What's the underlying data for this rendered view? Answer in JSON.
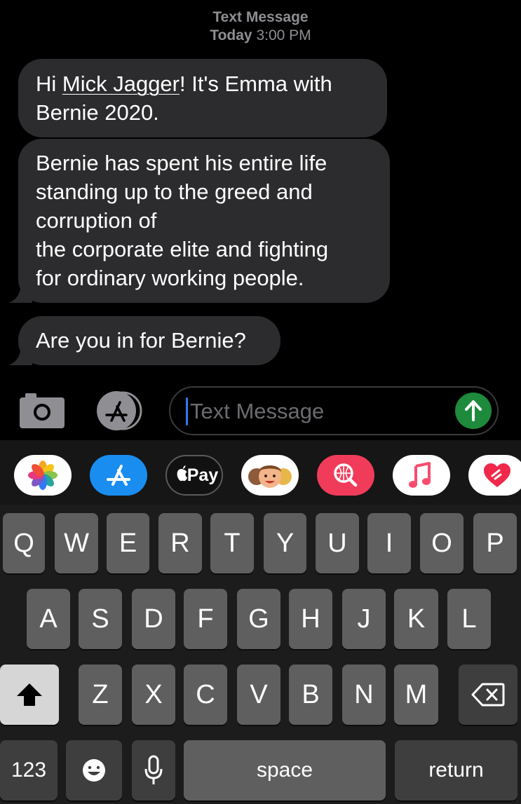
{
  "header": {
    "label": "Text Message",
    "day": "Today",
    "time": "3:00 PM"
  },
  "messages": [
    {
      "line1_prefix": "Hi ",
      "name": "Mick Jagger",
      "line1_suffix": "! It's Emma with",
      "line2": "Bernie 2020."
    },
    {
      "lines": [
        "Bernie has spent his entire life",
        "standing up to the greed and",
        "corruption of",
        "the corporate elite and fighting",
        "for ordinary working people."
      ]
    },
    {
      "text": "Are you in for Bernie?"
    }
  ],
  "input": {
    "placeholder": "Text Message"
  },
  "app_strip": [
    {
      "icon": "photos-icon"
    },
    {
      "icon": "app-store-icon"
    },
    {
      "icon": "apple-pay-icon",
      "label": "Pay"
    },
    {
      "icon": "memoji-icon"
    },
    {
      "icon": "web-search-icon"
    },
    {
      "icon": "music-icon"
    },
    {
      "icon": "digital-touch-icon"
    }
  ],
  "keyboard": {
    "row1": [
      "Q",
      "W",
      "E",
      "R",
      "T",
      "Y",
      "U",
      "I",
      "O",
      "P"
    ],
    "row2": [
      "A",
      "S",
      "D",
      "F",
      "G",
      "H",
      "J",
      "K",
      "L"
    ],
    "row3": [
      "Z",
      "X",
      "C",
      "V",
      "B",
      "N",
      "M"
    ],
    "numbers_label": "123",
    "space_label": "space",
    "return_label": "return"
  },
  "colors": {
    "background": "#000000",
    "bubble": "#2c2c2e",
    "send_button": "#1e8a3c",
    "caret": "#2f7bf5",
    "key": "#5f5f5f",
    "keyboard_bg": "#1c1c1c"
  }
}
